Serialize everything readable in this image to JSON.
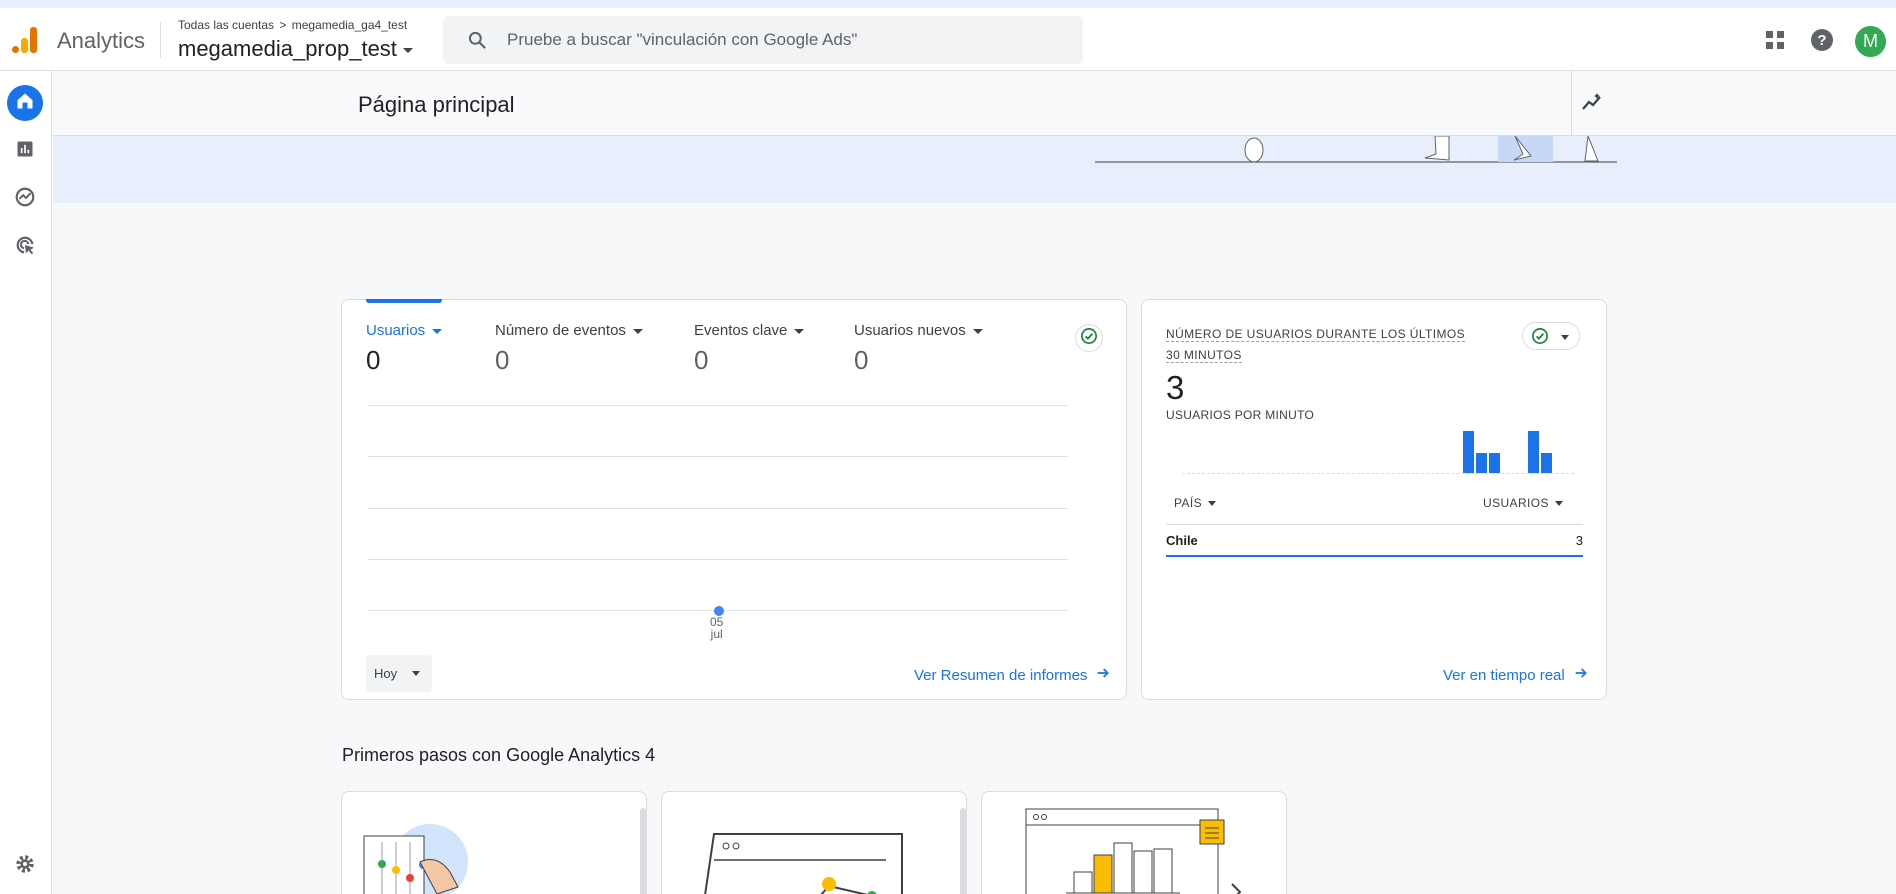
{
  "topbar": {
    "app_name": "Analytics",
    "breadcrumb": {
      "root": "Todas las cuentas",
      "account": "megamedia_ga4_test"
    },
    "property": "megamedia_prop_test",
    "search_placeholder": "Pruebe a buscar \"vinculación con Google Ads\"",
    "avatar_letter": "M",
    "icons": [
      "apps-grid-icon",
      "help-icon"
    ]
  },
  "sidebar": {
    "items": [
      "home-icon",
      "reports-icon",
      "explore-icon",
      "advertising-icon",
      "settings-icon"
    ],
    "active": "home"
  },
  "page": {
    "title": "Página principal"
  },
  "overview": {
    "metrics": [
      {
        "label": "Usuarios",
        "value": "0",
        "selected": true
      },
      {
        "label": "Número de eventos",
        "value": "0"
      },
      {
        "label": "Eventos clave",
        "value": "0"
      },
      {
        "label": "Usuarios nuevos",
        "value": "0"
      }
    ],
    "x_tick": {
      "day": "05",
      "month": "jul"
    },
    "date_range": "Hoy",
    "link": "Ver Resumen de informes"
  },
  "chart_data": {
    "type": "line",
    "series": [
      {
        "values": [
          0
        ]
      }
    ],
    "x": [
      "05 jul"
    ],
    "title": "",
    "xlabel": "",
    "ylabel": "",
    "grid": true
  },
  "realtime": {
    "title_line1": "NÚMERO DE USUARIOS DURANTE LOS ÚLTIMOS",
    "title_line2": "30 MINUTOS",
    "total": "3",
    "per_minute_label": "USUARIOS POR MINUTO",
    "bars_per_minute": [
      0,
      0,
      0,
      0,
      0,
      0,
      0,
      0,
      0,
      0,
      0,
      0,
      0,
      0,
      0,
      0,
      0,
      0,
      0,
      0,
      0,
      0,
      0,
      3,
      1.4,
      1.4,
      0,
      0,
      3,
      1.4
    ],
    "col_country": "PAÍS",
    "col_users": "USUARIOS",
    "rows": [
      {
        "country": "Chile",
        "users": "3"
      }
    ],
    "link": "Ver en tiempo real"
  },
  "getting_started": {
    "title": "Primeros pasos con Google Analytics 4"
  },
  "colors": {
    "accent": "#1a73e8",
    "success": "#188038",
    "avatar": "#34a853"
  }
}
